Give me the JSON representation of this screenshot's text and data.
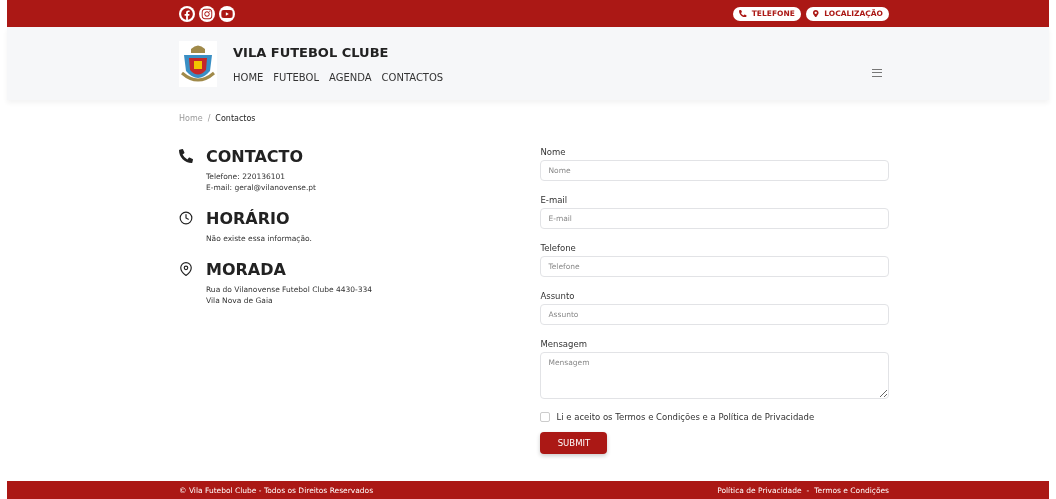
{
  "top_bar": {
    "social": [
      {
        "kind": "facebook"
      },
      {
        "kind": "instagram"
      },
      {
        "kind": "youtube"
      }
    ],
    "pills": [
      {
        "kind": "phone",
        "label": "TELEFONE"
      },
      {
        "kind": "pin",
        "label": "LOCALIZAÇÃO"
      }
    ]
  },
  "header": {
    "title": "VILA FUTEBOL CLUBE",
    "nav": [
      "HOME",
      "FUTEBOL",
      "AGENDA",
      "CONTACTOS"
    ]
  },
  "breadcrumb": {
    "items": [
      "Home",
      "Contactos"
    ],
    "separator": "/"
  },
  "info": [
    {
      "kind": "phone",
      "heading": "CONTACTO",
      "lines": [
        "Telefone: 220136101",
        "E-mail: geral@vilanovense.pt"
      ]
    },
    {
      "kind": "clock",
      "heading": "HORÁRIO",
      "lines": [
        "Não existe essa informação."
      ]
    },
    {
      "kind": "pin",
      "heading": "MORADA",
      "lines": [
        "Rua do Vilanovense Futebol Clube 4430-334",
        "Vila Nova de Gaia"
      ]
    }
  ],
  "form": {
    "fields": [
      {
        "kind": "input",
        "label": "Nome",
        "placeholder": "Nome"
      },
      {
        "kind": "input",
        "label": "E-mail",
        "placeholder": "E-mail"
      },
      {
        "kind": "input",
        "label": "Telefone",
        "placeholder": "Telefone"
      },
      {
        "kind": "input",
        "label": "Assunto",
        "placeholder": "Assunto"
      },
      {
        "kind": "textarea",
        "label": "Mensagem",
        "placeholder": "Mensagem"
      }
    ],
    "consent": {
      "label": "Li e aceito os Termos e Condições e a Política de Privacidade",
      "checked": false
    },
    "submit": "SUBMIT"
  },
  "footer": {
    "copyright": "© Vila Futebol Clube - Todos os Direitos Reservados",
    "links": [
      "Política de Privacidade",
      "Termos e Condições"
    ],
    "separator": "-"
  }
}
